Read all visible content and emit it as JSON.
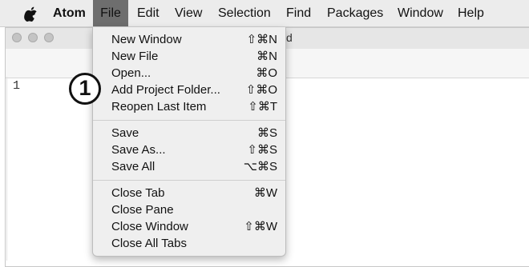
{
  "menubar": {
    "app_name": "Atom",
    "menus": [
      "File",
      "Edit",
      "View",
      "Selection",
      "Find",
      "Packages",
      "Window",
      "Help"
    ],
    "active_menu": "File"
  },
  "window": {
    "title_fragment": "d",
    "line_number": "1"
  },
  "file_menu": {
    "groups": [
      [
        {
          "label": "New Window",
          "shortcut": "⇧⌘N"
        },
        {
          "label": "New File",
          "shortcut": "⌘N"
        },
        {
          "label": "Open...",
          "shortcut": "⌘O"
        },
        {
          "label": "Add Project Folder...",
          "shortcut": "⇧⌘O"
        },
        {
          "label": "Reopen Last Item",
          "shortcut": "⇧⌘T"
        }
      ],
      [
        {
          "label": "Save",
          "shortcut": "⌘S"
        },
        {
          "label": "Save As...",
          "shortcut": "⇧⌘S"
        },
        {
          "label": "Save All",
          "shortcut": "⌥⌘S"
        }
      ],
      [
        {
          "label": "Close Tab",
          "shortcut": "⌘W"
        },
        {
          "label": "Close Pane",
          "shortcut": ""
        },
        {
          "label": "Close Window",
          "shortcut": "⇧⌘W"
        },
        {
          "label": "Close All Tabs",
          "shortcut": ""
        }
      ]
    ]
  },
  "callout": {
    "number": "1"
  },
  "colors": {
    "menubar_bg": "#ececec",
    "active_menu_bg": "#6e6e6e",
    "dropdown_bg": "#efefef"
  }
}
